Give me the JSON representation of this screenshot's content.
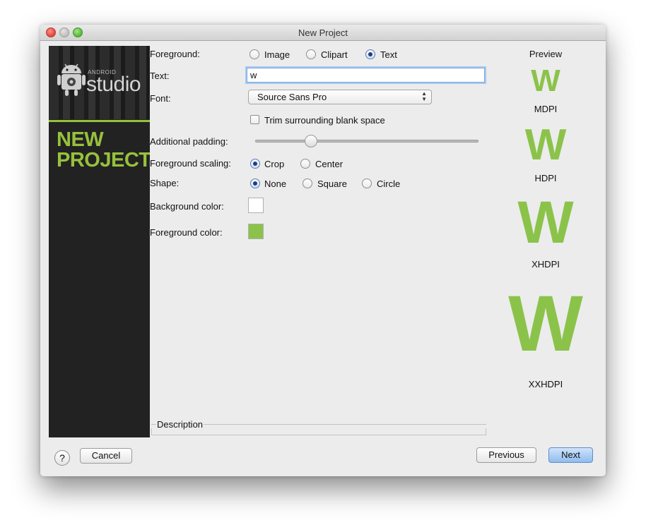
{
  "window": {
    "title": "New Project"
  },
  "sidebar": {
    "android_label": "ANDROID",
    "studio_label": "studio",
    "heading_line1": "NEW",
    "heading_line2": "PROJECT",
    "accent_color": "#97c13c"
  },
  "form": {
    "foreground": {
      "label": "Foreground:",
      "options": [
        "Image",
        "Clipart",
        "Text"
      ],
      "selected": "Text"
    },
    "text": {
      "label": "Text:",
      "value": "w"
    },
    "font": {
      "label": "Font:",
      "value": "Source Sans Pro"
    },
    "trim": {
      "label": "Trim surrounding blank space",
      "checked": false
    },
    "padding": {
      "label": "Additional padding:",
      "value_fraction": 0.25
    },
    "scaling": {
      "label": "Foreground scaling:",
      "options": [
        "Crop",
        "Center"
      ],
      "selected": "Crop"
    },
    "shape": {
      "label": "Shape:",
      "options": [
        "None",
        "Square",
        "Circle"
      ],
      "selected": "None"
    },
    "background_color": {
      "label": "Background color:",
      "value": "#ffffff"
    },
    "foreground_color": {
      "label": "Foreground color:",
      "value": "#8bc34a"
    }
  },
  "description": {
    "label": "Description"
  },
  "preview": {
    "title": "Preview",
    "glyph": "W",
    "items": [
      {
        "density": "MDPI"
      },
      {
        "density": "HDPI"
      },
      {
        "density": "XHDPI"
      },
      {
        "density": "XXHDPI"
      }
    ]
  },
  "buttons": {
    "help": "?",
    "cancel": "Cancel",
    "previous": "Previous",
    "next": "Next"
  }
}
